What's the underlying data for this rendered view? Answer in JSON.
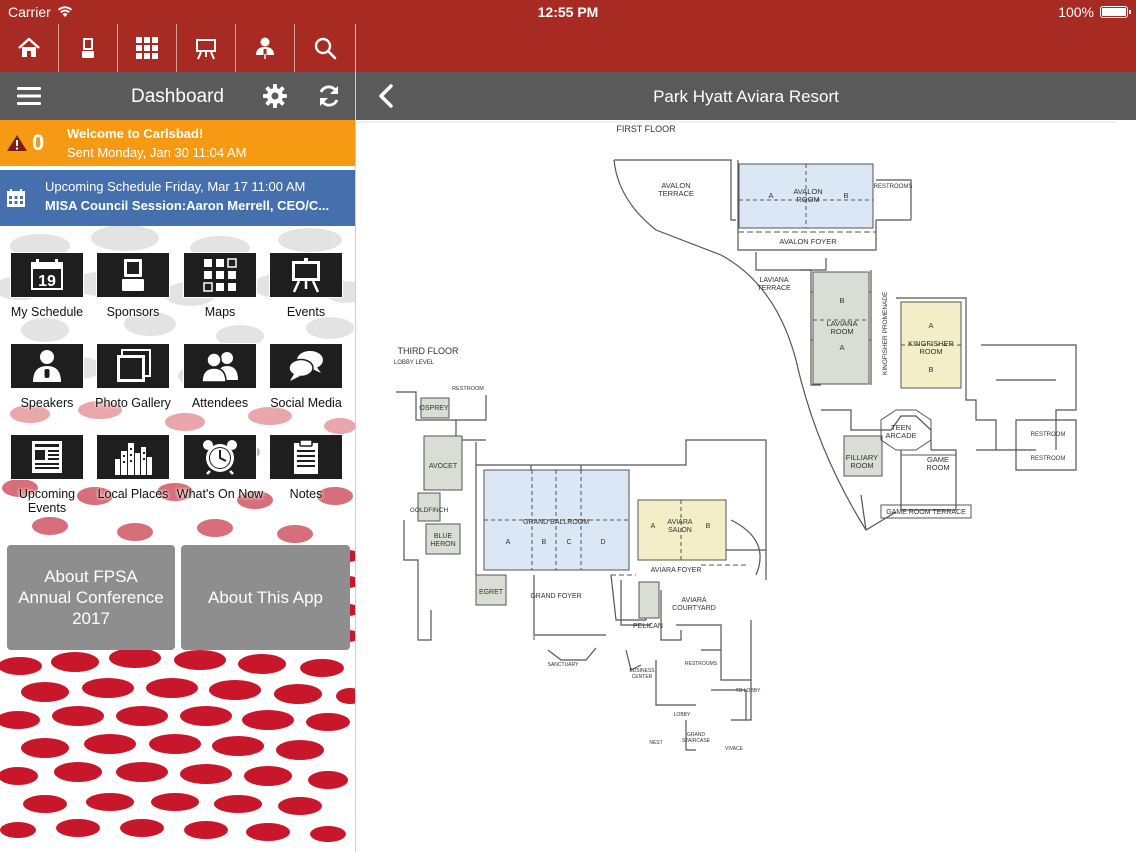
{
  "status_bar": {
    "carrier": "Carrier",
    "time": "12:55 PM",
    "battery": "100%"
  },
  "top_nav": {
    "icons": [
      "home-icon",
      "sponsors-icon",
      "maps-icon",
      "events-icon",
      "speakers-icon",
      "search-icon"
    ]
  },
  "dashboard": {
    "title": "Dashboard"
  },
  "alert": {
    "count": "0",
    "headline": "Welcome to Carlsbad!",
    "sent": "Sent Monday, Jan 30 11:04 AM"
  },
  "schedule": {
    "line1": "Upcoming Schedule Friday, Mar 17 11:00 AM",
    "line2": "MISA Council Session:Aaron Merrell, CEO/C..."
  },
  "tiles": [
    {
      "label": "My Schedule",
      "icon": "calendar-icon",
      "day": "19"
    },
    {
      "label": "Sponsors",
      "icon": "sponsors-icon"
    },
    {
      "label": "Maps",
      "icon": "maps-icon"
    },
    {
      "label": "Events",
      "icon": "events-icon"
    },
    {
      "label": "Speakers",
      "icon": "speakers-icon"
    },
    {
      "label": "Photo Gallery",
      "icon": "photo-gallery-icon"
    },
    {
      "label": "Attendees",
      "icon": "attendees-icon"
    },
    {
      "label": "Social Media",
      "icon": "social-media-icon"
    },
    {
      "label": "Upcoming Events",
      "icon": "upcoming-events-icon"
    },
    {
      "label": "Local Places",
      "icon": "local-places-icon"
    },
    {
      "label": "What's On Now",
      "icon": "alarm-clock-icon"
    },
    {
      "label": "Notes",
      "icon": "notes-icon"
    }
  ],
  "buttons": {
    "about_conference": "About FPSA Annual Conference 2017",
    "about_app": "About This App"
  },
  "map_view": {
    "title": "Park Hyatt Aviara Resort",
    "labels": {
      "first_floor": "FIRST FLOOR",
      "third_floor": "THIRD FLOOR",
      "lobby_level": "LOBBY LEVEL",
      "avalon_terrace_1": "AVALON",
      "avalon_terrace_2": "TERRACE",
      "avalon_room_1": "AVALON",
      "avalon_room_2": "ROOM",
      "a": "A",
      "b": "B",
      "c": "C",
      "d": "D",
      "restrooms": "RESTROOMS",
      "avalon_foyer": "AVALON FOYER",
      "laviana_terrace_1": "LAVIANA",
      "laviana_terrace_2": "TERRACE",
      "laviana_room_1": "LAVIANA",
      "laviana_room_2": "ROOM",
      "kingfisher_promenade": "KINGFISHER PROMENADE",
      "kingfisher_room_1": "KINGFISHER",
      "kingfisher_room_2": "ROOM",
      "teen_arcade_1": "TEEN",
      "teen_arcade_2": "ARCADE",
      "filliary_room_1": "FILLIARY",
      "filliary_room_2": "ROOM",
      "game_room_1": "GAME",
      "game_room_2": "ROOM",
      "game_room_terrace": "GAME ROOM TERRACE",
      "restroom": "RESTROOM",
      "osprey": "OSPREY",
      "restroom_small": "RESTROOM",
      "avocet": "AVOCET",
      "goldfinch": "GOLDFINCH",
      "blue_heron_1": "BLUE",
      "blue_heron_2": "HERON",
      "egret": "EGRET",
      "grand_ballroom": "GRAND BALLROOM",
      "grand_foyer": "GRAND FOYER",
      "aviara_salon_1": "AVIARA",
      "aviara_salon_2": "SALON",
      "aviara_foyer": "AVIARA FOYER",
      "aviara_courtyard_1": "AVIARA",
      "aviara_courtyard_2": "COURTYARD",
      "pelican": "PELICAN",
      "sanctuary": "SANCTUARY",
      "business_center_1": "BUSINESS",
      "business_center_2": "CENTER",
      "restrooms_lower": "RESTROOMS",
      "to_lobby": "TO LOBBY",
      "lobby": "LOBBY",
      "grand_staircase_1": "GRAND",
      "grand_staircase_2": "STAIRCASE",
      "nest": "NEST",
      "vivace": "VIVACE"
    }
  },
  "colors": {
    "brand_red": "#a72b22",
    "toolbar_gray": "#5a5a5a",
    "alert_orange": "#f59a12",
    "schedule_blue": "#4570ad",
    "room_blue": "#dbe7f5",
    "room_yellow": "#f3eec7",
    "room_green": "#d9ddd3"
  }
}
